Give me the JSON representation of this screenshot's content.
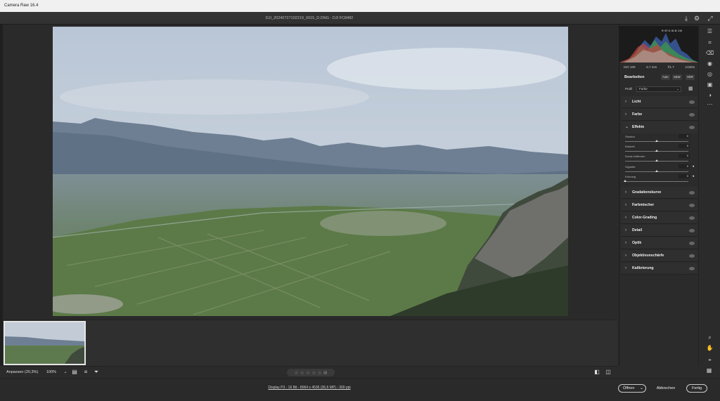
{
  "window": {
    "title": "Camera Raw 16.4"
  },
  "header": {
    "filename": "DJI_20240727102219_0015_D.DNG - DJI FC8482"
  },
  "histogram": {
    "clip_info": "R: 87  G: 81  B: 219"
  },
  "camera": {
    "iso": "ISO 100",
    "focal": "6.7 mm",
    "aperture": "f/1.7",
    "shutter": "1/320s"
  },
  "edit": {
    "label": "Bearbeiten",
    "auto": "Auto",
    "bw": "S&W",
    "hdr": "HDR"
  },
  "profile": {
    "label": "Profil",
    "value": "Farbe"
  },
  "sections": [
    {
      "label": "Licht",
      "open": false
    },
    {
      "label": "Farbe",
      "open": false
    },
    {
      "label": "Effekte",
      "open": true
    },
    {
      "label": "Gradationskurve",
      "open": false
    },
    {
      "label": "Farbmischer",
      "open": false
    },
    {
      "label": "Color-Grading",
      "open": false
    },
    {
      "label": "Detail",
      "open": false
    },
    {
      "label": "Optik",
      "open": false
    },
    {
      "label": "Objektivunschärfe",
      "open": false
    },
    {
      "label": "Kalibrierung",
      "open": false
    }
  ],
  "effects": [
    {
      "label": "Struktur",
      "value": "0",
      "position": 0.5
    },
    {
      "label": "Klarheit",
      "value": "0",
      "position": 0.5
    },
    {
      "label": "Dunst entfernen",
      "value": "0",
      "position": 0.5
    },
    {
      "label": "Vignette",
      "value": "0",
      "position": 0.5
    },
    {
      "label": "Körnung",
      "value": "0",
      "position": 0.0
    }
  ],
  "bottom": {
    "zoom_fit": "Anpassen (20,3%)",
    "zoom_pct": "100%"
  },
  "status": {
    "info": "Display P3 - 16 Bit - 8064 x 4536 (36,6 MP) - 300 ppi",
    "open": "Öffnen",
    "cancel": "Abbrechen",
    "done": "Fertig"
  },
  "colors": {
    "accent": "#e5e5e5",
    "panel": "#2b2b2b",
    "background": "#1e1e1e"
  },
  "tools": [
    "expand-icon",
    "edit-icon",
    "crop-icon",
    "eraser-icon",
    "red-eye-icon",
    "mask-icon",
    "snapshots-icon",
    "presets-icon",
    "more-icon",
    "zoom-icon",
    "hand-icon",
    "sampler-icon",
    "grid-icon"
  ]
}
